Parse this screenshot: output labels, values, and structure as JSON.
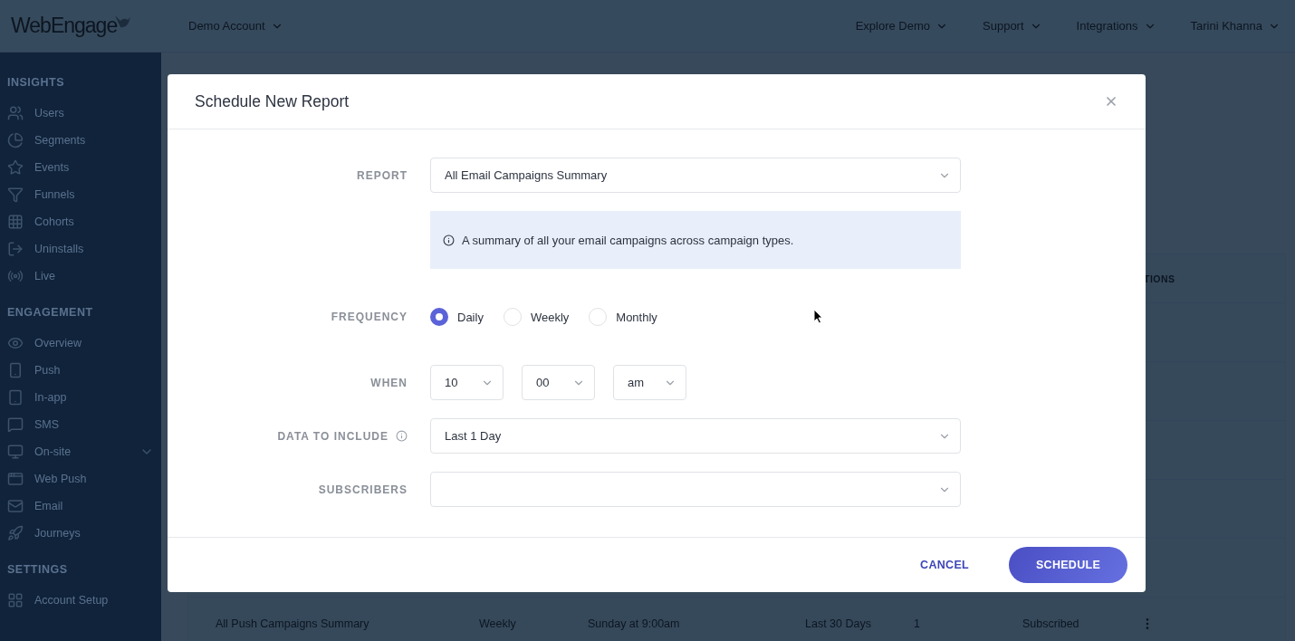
{
  "topbar": {
    "logo": "WebEngage",
    "account": "Demo Account",
    "menus": [
      {
        "label": "Explore Demo"
      },
      {
        "label": "Support"
      },
      {
        "label": "Integrations"
      },
      {
        "label": "Tarini Khanna"
      }
    ]
  },
  "sidebar": {
    "sections": [
      {
        "title": "INSIGHTS",
        "items": [
          {
            "label": "Users"
          },
          {
            "label": "Segments"
          },
          {
            "label": "Events"
          },
          {
            "label": "Funnels"
          },
          {
            "label": "Cohorts"
          },
          {
            "label": "Uninstalls"
          },
          {
            "label": "Live"
          }
        ]
      },
      {
        "title": "ENGAGEMENT",
        "items": [
          {
            "label": "Overview"
          },
          {
            "label": "Push"
          },
          {
            "label": "In-app"
          },
          {
            "label": "SMS"
          },
          {
            "label": "On-site",
            "expandable": true
          },
          {
            "label": "Web Push"
          },
          {
            "label": "Email"
          },
          {
            "label": "Journeys"
          }
        ]
      },
      {
        "title": "SETTINGS",
        "items": [
          {
            "label": "Account Setup"
          }
        ]
      }
    ]
  },
  "table": {
    "column_7_header": "TIONS",
    "rows": [
      {
        "cells": [
          "All Push Campaigns Summary",
          "Weekly",
          "Sunday at 9:00am",
          "Last 30 Days",
          "1",
          "Subscribed"
        ]
      }
    ]
  },
  "dialog": {
    "title": "Schedule New Report",
    "report": {
      "label": "REPORT",
      "value": "All Email Campaigns Summary",
      "info": "A summary of all your email campaigns across campaign types."
    },
    "frequency": {
      "label": "FREQUENCY",
      "options": [
        {
          "label": "Daily",
          "selected": true
        },
        {
          "label": "Weekly",
          "selected": false
        },
        {
          "label": "Monthly",
          "selected": false
        }
      ]
    },
    "when": {
      "label": "WHEN",
      "selects": [
        {
          "value": "10"
        },
        {
          "value": "00"
        },
        {
          "value": "am"
        }
      ]
    },
    "data_to_include": {
      "label": "DATA TO INCLUDE",
      "value": "Last 1 Day"
    },
    "subscribers": {
      "label": "SUBSCRIBERS"
    },
    "buttons": [
      {
        "label": "CANCEL",
        "kind": "text"
      },
      {
        "label": "SCHEDULE",
        "kind": "primary"
      }
    ]
  }
}
